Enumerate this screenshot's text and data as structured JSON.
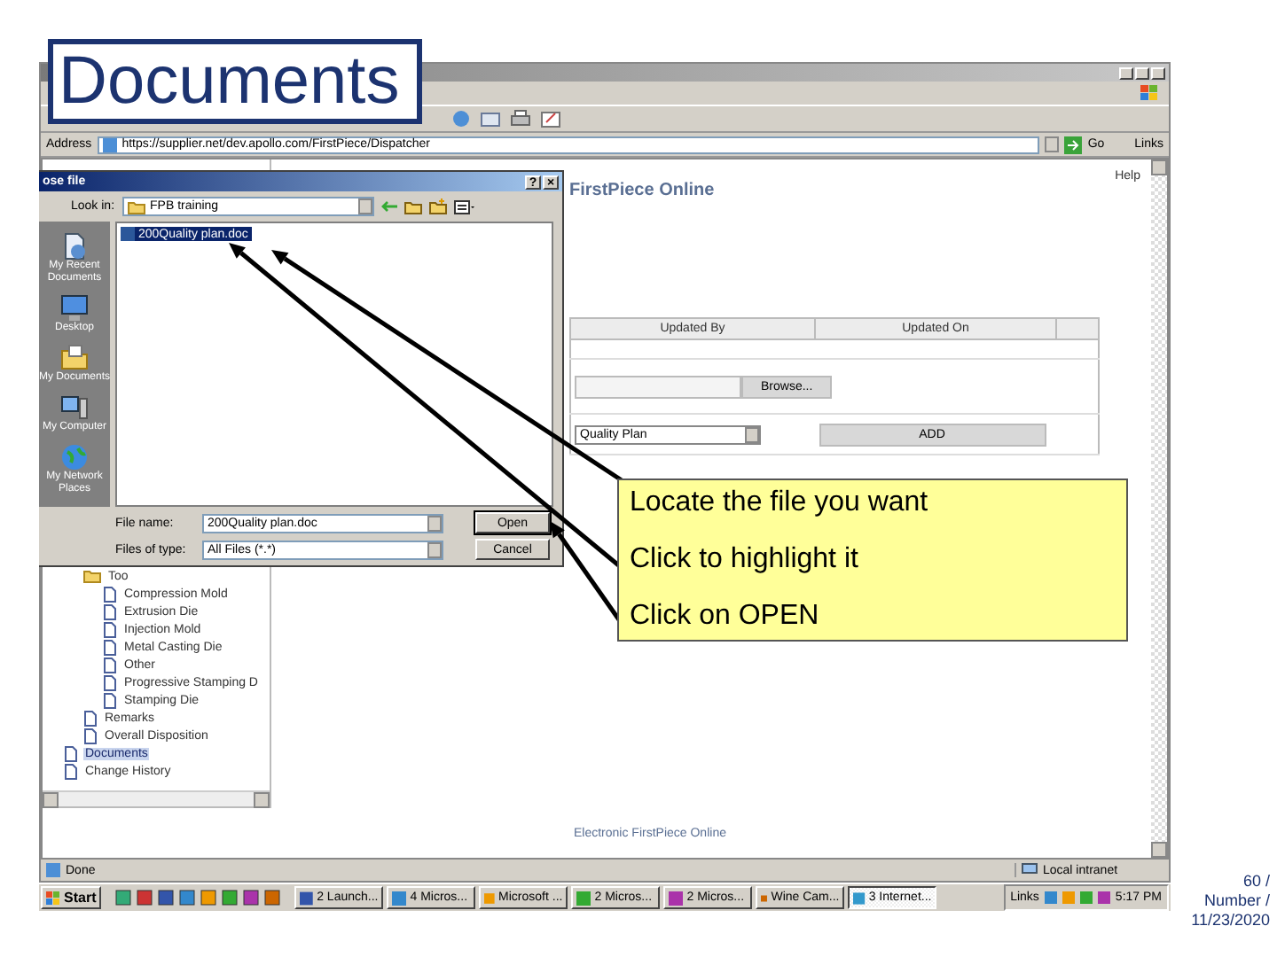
{
  "slide_title": "Documents",
  "browser": {
    "address_label": "Address",
    "address": "https://supplier.net/dev.apollo.com/FirstPiece/Dispatcher",
    "go": "Go",
    "links": "Links",
    "help": "Help",
    "page_title": "FirstPiece Online",
    "table": {
      "columns": [
        "Updated By",
        "Updated On"
      ],
      "browse_button": "Browse...",
      "document_type": "Quality Plan",
      "add_button": "ADD"
    },
    "tree": [
      {
        "children": [
          {
            "label": "Too",
            "selected": false,
            "children": [
              {
                "label": "Compression Mold",
                "selected": false
              },
              {
                "label": "Extrusion Die",
                "selected": false
              },
              {
                "label": "Injection Mold",
                "selected": false
              },
              {
                "label": "Metal Casting Die",
                "selected": false
              },
              {
                "label": "Other",
                "selected": false
              },
              {
                "label": "Progressive Stamping D",
                "selected": false
              },
              {
                "label": "Stamping Die",
                "selected": false
              }
            ]
          },
          {
            "label": "Remarks",
            "selected": false
          },
          {
            "label": "Overall Disposition",
            "selected": false
          }
        ]
      },
      {
        "label": "Documents",
        "selected": true
      },
      {
        "label": "Change History",
        "selected": false
      }
    ],
    "page_footer": "Electronic FirstPiece Online",
    "status": "Done",
    "zone": "Local intranet"
  },
  "dialog": {
    "title": "ose file",
    "help_button": "?",
    "close_button": "×",
    "look_in_label": "Look in:",
    "folder": "FPB training",
    "places": [
      "My Recent Documents",
      "Desktop",
      "My Documents",
      "My Computer",
      "My Network Places"
    ],
    "files": [
      {
        "name": "200Quality plan.doc",
        "selected": true
      }
    ],
    "file_name_label": "File name:",
    "file_name": "200Quality plan.doc",
    "file_type_label": "Files of type:",
    "file_type": "All Files (*.*)",
    "open_button": "Open",
    "cancel_button": "Cancel"
  },
  "taskbar": {
    "start": "Start",
    "tasks": [
      {
        "label": "2 Launch...",
        "selected": false
      },
      {
        "label": "4 Micros...",
        "selected": false
      },
      {
        "label": "Microsoft ...",
        "selected": false
      },
      {
        "label": "2 Micros...",
        "selected": false
      },
      {
        "label": "2 Micros...",
        "selected": false
      },
      {
        "label": "Wine Cam...",
        "selected": false
      },
      {
        "label": "3 Internet...",
        "selected": true
      }
    ],
    "links": "Links",
    "clock": "5:17 PM"
  },
  "callout": [
    "Locate the file you want",
    "Click to highlight it",
    "Click on OPEN"
  ],
  "slide_footer": [
    "60 /",
    "Number /",
    "11/23/2020"
  ]
}
